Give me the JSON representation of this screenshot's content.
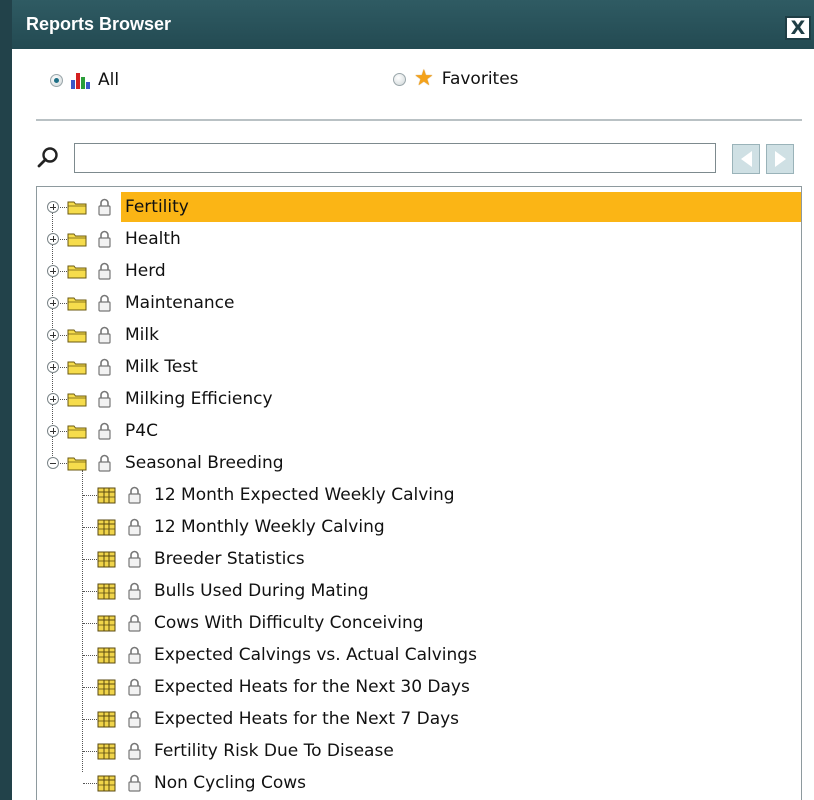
{
  "window": {
    "title": "Reports Browser",
    "close_label": "X"
  },
  "filter": {
    "all_label": "All",
    "favorites_label": "Favorites",
    "selected": "All"
  },
  "search": {
    "value": "",
    "placeholder": ""
  },
  "tree": {
    "folders": [
      {
        "label": "Fertility",
        "expanded": false,
        "selected": true
      },
      {
        "label": "Health",
        "expanded": false
      },
      {
        "label": "Herd",
        "expanded": false
      },
      {
        "label": "Maintenance",
        "expanded": false
      },
      {
        "label": "Milk",
        "expanded": false
      },
      {
        "label": "Milk Test",
        "expanded": false
      },
      {
        "label": "Milking Efficiency",
        "expanded": false
      },
      {
        "label": "P4C",
        "expanded": false
      },
      {
        "label": "Seasonal Breeding",
        "expanded": true
      }
    ],
    "reports": [
      {
        "label": "12 Month Expected Weekly Calving"
      },
      {
        "label": "12 Monthly Weekly Calving"
      },
      {
        "label": "Breeder Statistics"
      },
      {
        "label": "Bulls Used During Mating"
      },
      {
        "label": "Cows With Difficulty Conceiving"
      },
      {
        "label": "Expected Calvings vs. Actual Calvings"
      },
      {
        "label": "Expected Heats for the Next 30 Days"
      },
      {
        "label": "Expected Heats for the Next 7 Days"
      },
      {
        "label": "Fertility Risk Due To Disease"
      },
      {
        "label": "Non Cycling Cows"
      }
    ]
  },
  "colors": {
    "titlebar": "#2a525a",
    "selection": "#fbb515",
    "folder": "#f6dc4c",
    "star": "#f4a21a"
  }
}
